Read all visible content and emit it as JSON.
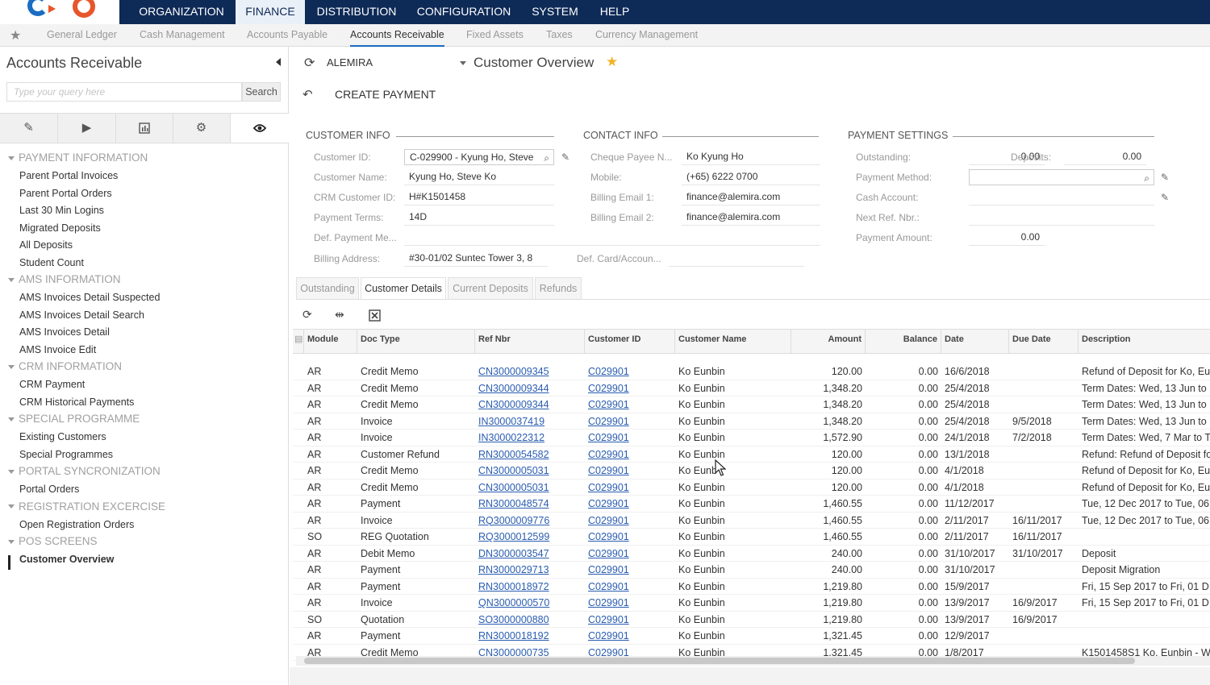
{
  "topnav": [
    "ORGANIZATION",
    "FINANCE",
    "DISTRIBUTION",
    "CONFIGURATION",
    "SYSTEM",
    "HELP"
  ],
  "subnav": [
    "General Ledger",
    "Cash Management",
    "Accounts Payable",
    "Accounts Receivable",
    "Fixed Assets",
    "Taxes",
    "Currency Management"
  ],
  "sidebar": {
    "title": "Accounts Receivable",
    "search_placeholder": "Type your query here",
    "search_button": "Search",
    "sections": [
      {
        "title": "PAYMENT INFORMATION",
        "items": [
          "Parent Portal Invoices",
          "Parent Portal Orders",
          "Last 30 Min Logins",
          "Migrated Deposits",
          "All Deposits",
          "Student Count"
        ]
      },
      {
        "title": "AMS INFORMATION",
        "items": [
          "AMS Invoices Detail Suspected",
          "AMS Invoices Detail Search",
          "AMS Invoices Detail",
          "AMS Invoice Edit"
        ]
      },
      {
        "title": "CRM INFORMATION",
        "items": [
          "CRM Payment",
          "CRM Historical Payments"
        ]
      },
      {
        "title": "SPECIAL PROGRAMME",
        "items": [
          "Existing Customers",
          "Special Programmes"
        ]
      },
      {
        "title": "PORTAL SYNCRONIZATION",
        "items": [
          "Portal Orders"
        ]
      },
      {
        "title": "REGISTRATION EXCERCISE",
        "items": [
          "Open Registration Orders"
        ]
      },
      {
        "title": "POS SCREENS",
        "items": [
          "Customer Overview"
        ]
      }
    ]
  },
  "main": {
    "company": "ALEMIRA",
    "screen_title": "Customer Overview",
    "action": "CREATE PAYMENT",
    "customer_info": {
      "header": "CUSTOMER INFO",
      "customer_id_label": "Customer ID:",
      "customer_id": "C-029900 - Kyung Ho, Steve",
      "customer_name_label": "Customer Name:",
      "customer_name": "Kyung Ho, Steve  Ko",
      "crm_id_label": "CRM Customer ID:",
      "crm_id": "H#K1501458",
      "payment_terms_label": "Payment Terms:",
      "payment_terms": "14D",
      "def_payment_label": "Def. Payment Me...",
      "billing_address_label": "Billing Address:",
      "billing_address": "#30-01/02 Suntec Tower 3, 8"
    },
    "contact_info": {
      "header": "CONTACT INFO",
      "payee_label": "Cheque Payee N...",
      "payee": "Ko Kyung Ho",
      "mobile_label": "Mobile:",
      "mobile": "(+65) 6222 0700",
      "email1_label": "Billing Email 1:",
      "email1": "finance@alemira.com",
      "email2_label": "Billing Email 2:",
      "email2": "finance@alemira.com",
      "def_card_label": "Def. Card/Accoun..."
    },
    "payment_settings": {
      "header": "PAYMENT SETTINGS",
      "outstanding_label": "Outstanding:",
      "outstanding": "0.00",
      "deposits_label": "Deposits:",
      "deposits": "0.00",
      "payment_method_label": "Payment Method:",
      "cash_account_label": "Cash Account:",
      "next_ref_label": "Next Ref. Nbr.:",
      "payment_amount_label": "Payment Amount:",
      "payment_amount": "0.00"
    },
    "tabs": [
      "Outstanding",
      "Customer Details",
      "Current Deposits",
      "Refunds"
    ],
    "grid_columns": [
      "Module",
      "Doc Type",
      "Ref Nbr",
      "Customer ID",
      "Customer Name",
      "Amount",
      "Balance",
      "Date",
      "Due Date",
      "Description"
    ],
    "grid_rows": [
      [
        "AR",
        "Credit Memo",
        "CN3000009345",
        "C029901",
        "Ko Eunbin",
        "120.00",
        "0.00",
        "16/6/2018",
        "",
        "Refund of Deposit for Ko, Eu"
      ],
      [
        "AR",
        "Credit Memo",
        "CN3000009344",
        "C029901",
        "Ko Eunbin",
        "1,348.20",
        "0.00",
        "25/4/2018",
        "",
        "Term Dates: Wed, 13 Jun to"
      ],
      [
        "AR",
        "Credit Memo",
        "CN3000009344",
        "C029901",
        "Ko Eunbin",
        "1,348.20",
        "0.00",
        "25/4/2018",
        "",
        "Term Dates: Wed, 13 Jun to"
      ],
      [
        "AR",
        "Invoice",
        "IN3000037419",
        "C029901",
        "Ko Eunbin",
        "1,348.20",
        "0.00",
        "25/4/2018",
        "9/5/2018",
        "Term Dates: Wed, 13 Jun to"
      ],
      [
        "AR",
        "Invoice",
        "IN3000022312",
        "C029901",
        "Ko Eunbin",
        "1,572.90",
        "0.00",
        "24/1/2018",
        "7/2/2018",
        "Term Dates: Wed, 7 Mar to T"
      ],
      [
        "AR",
        "Customer Refund",
        "RN3000054582",
        "C029901",
        "Ko Eunbin",
        "120.00",
        "0.00",
        "13/1/2018",
        "",
        "Refund: Refund of Deposit fo"
      ],
      [
        "AR",
        "Credit Memo",
        "CN3000005031",
        "C029901",
        "Ko Eunb",
        "120.00",
        "0.00",
        "4/1/2018",
        "",
        "Refund of Deposit for Ko, Eu"
      ],
      [
        "AR",
        "Credit Memo",
        "CN3000005031",
        "C029901",
        "Ko Eunbin",
        "120.00",
        "0.00",
        "4/1/2018",
        "",
        "Refund of Deposit for Ko, Eu"
      ],
      [
        "AR",
        "Payment",
        "RN3000048574",
        "C029901",
        "Ko Eunbin",
        "1,460.55",
        "0.00",
        "11/12/2017",
        "",
        "Tue, 12 Dec 2017 to Tue, 06"
      ],
      [
        "AR",
        "Invoice",
        "RQ3000009776",
        "C029901",
        "Ko Eunbin",
        "1,460.55",
        "0.00",
        "2/11/2017",
        "16/11/2017",
        "Tue, 12 Dec 2017 to Tue, 06"
      ],
      [
        "SO",
        "REG Quotation",
        "RQ3000012599",
        "C029901",
        "Ko Eunbin",
        "1,460.55",
        "0.00",
        "2/11/2017",
        "16/11/2017",
        ""
      ],
      [
        "AR",
        "Debit Memo",
        "DN3000003547",
        "C029901",
        "Ko Eunbin",
        "240.00",
        "0.00",
        "31/10/2017",
        "31/10/2017",
        "Deposit"
      ],
      [
        "AR",
        "Payment",
        "RN3000029713",
        "C029901",
        "Ko Eunbin",
        "240.00",
        "0.00",
        "31/10/2017",
        "",
        "Deposit Migration"
      ],
      [
        "AR",
        "Payment",
        "RN3000018972",
        "C029901",
        "Ko Eunbin",
        "1,219.80",
        "0.00",
        "15/9/2017",
        "",
        "Fri, 15 Sep 2017 to Fri, 01 D"
      ],
      [
        "AR",
        "Invoice",
        "QN3000000570",
        "C029901",
        "Ko Eunbin",
        "1,219.80",
        "0.00",
        "13/9/2017",
        "16/9/2017",
        "Fri, 15 Sep 2017 to Fri, 01 D"
      ],
      [
        "SO",
        "Quotation",
        "SO3000000880",
        "C029901",
        "Ko Eunbin",
        "1,219.80",
        "0.00",
        "13/9/2017",
        "16/9/2017",
        ""
      ],
      [
        "AR",
        "Payment",
        "RN3000018192",
        "C029901",
        "Ko Eunbin",
        "1,321.45",
        "0.00",
        "12/9/2017",
        "",
        ""
      ],
      [
        "AR",
        "Credit Memo",
        "CN3000000735",
        "C029901",
        "Ko Eunbin",
        "1,321.45",
        "0.00",
        "1/8/2017",
        "",
        "K1501458S1 Ko, Eunbin - W"
      ]
    ]
  }
}
